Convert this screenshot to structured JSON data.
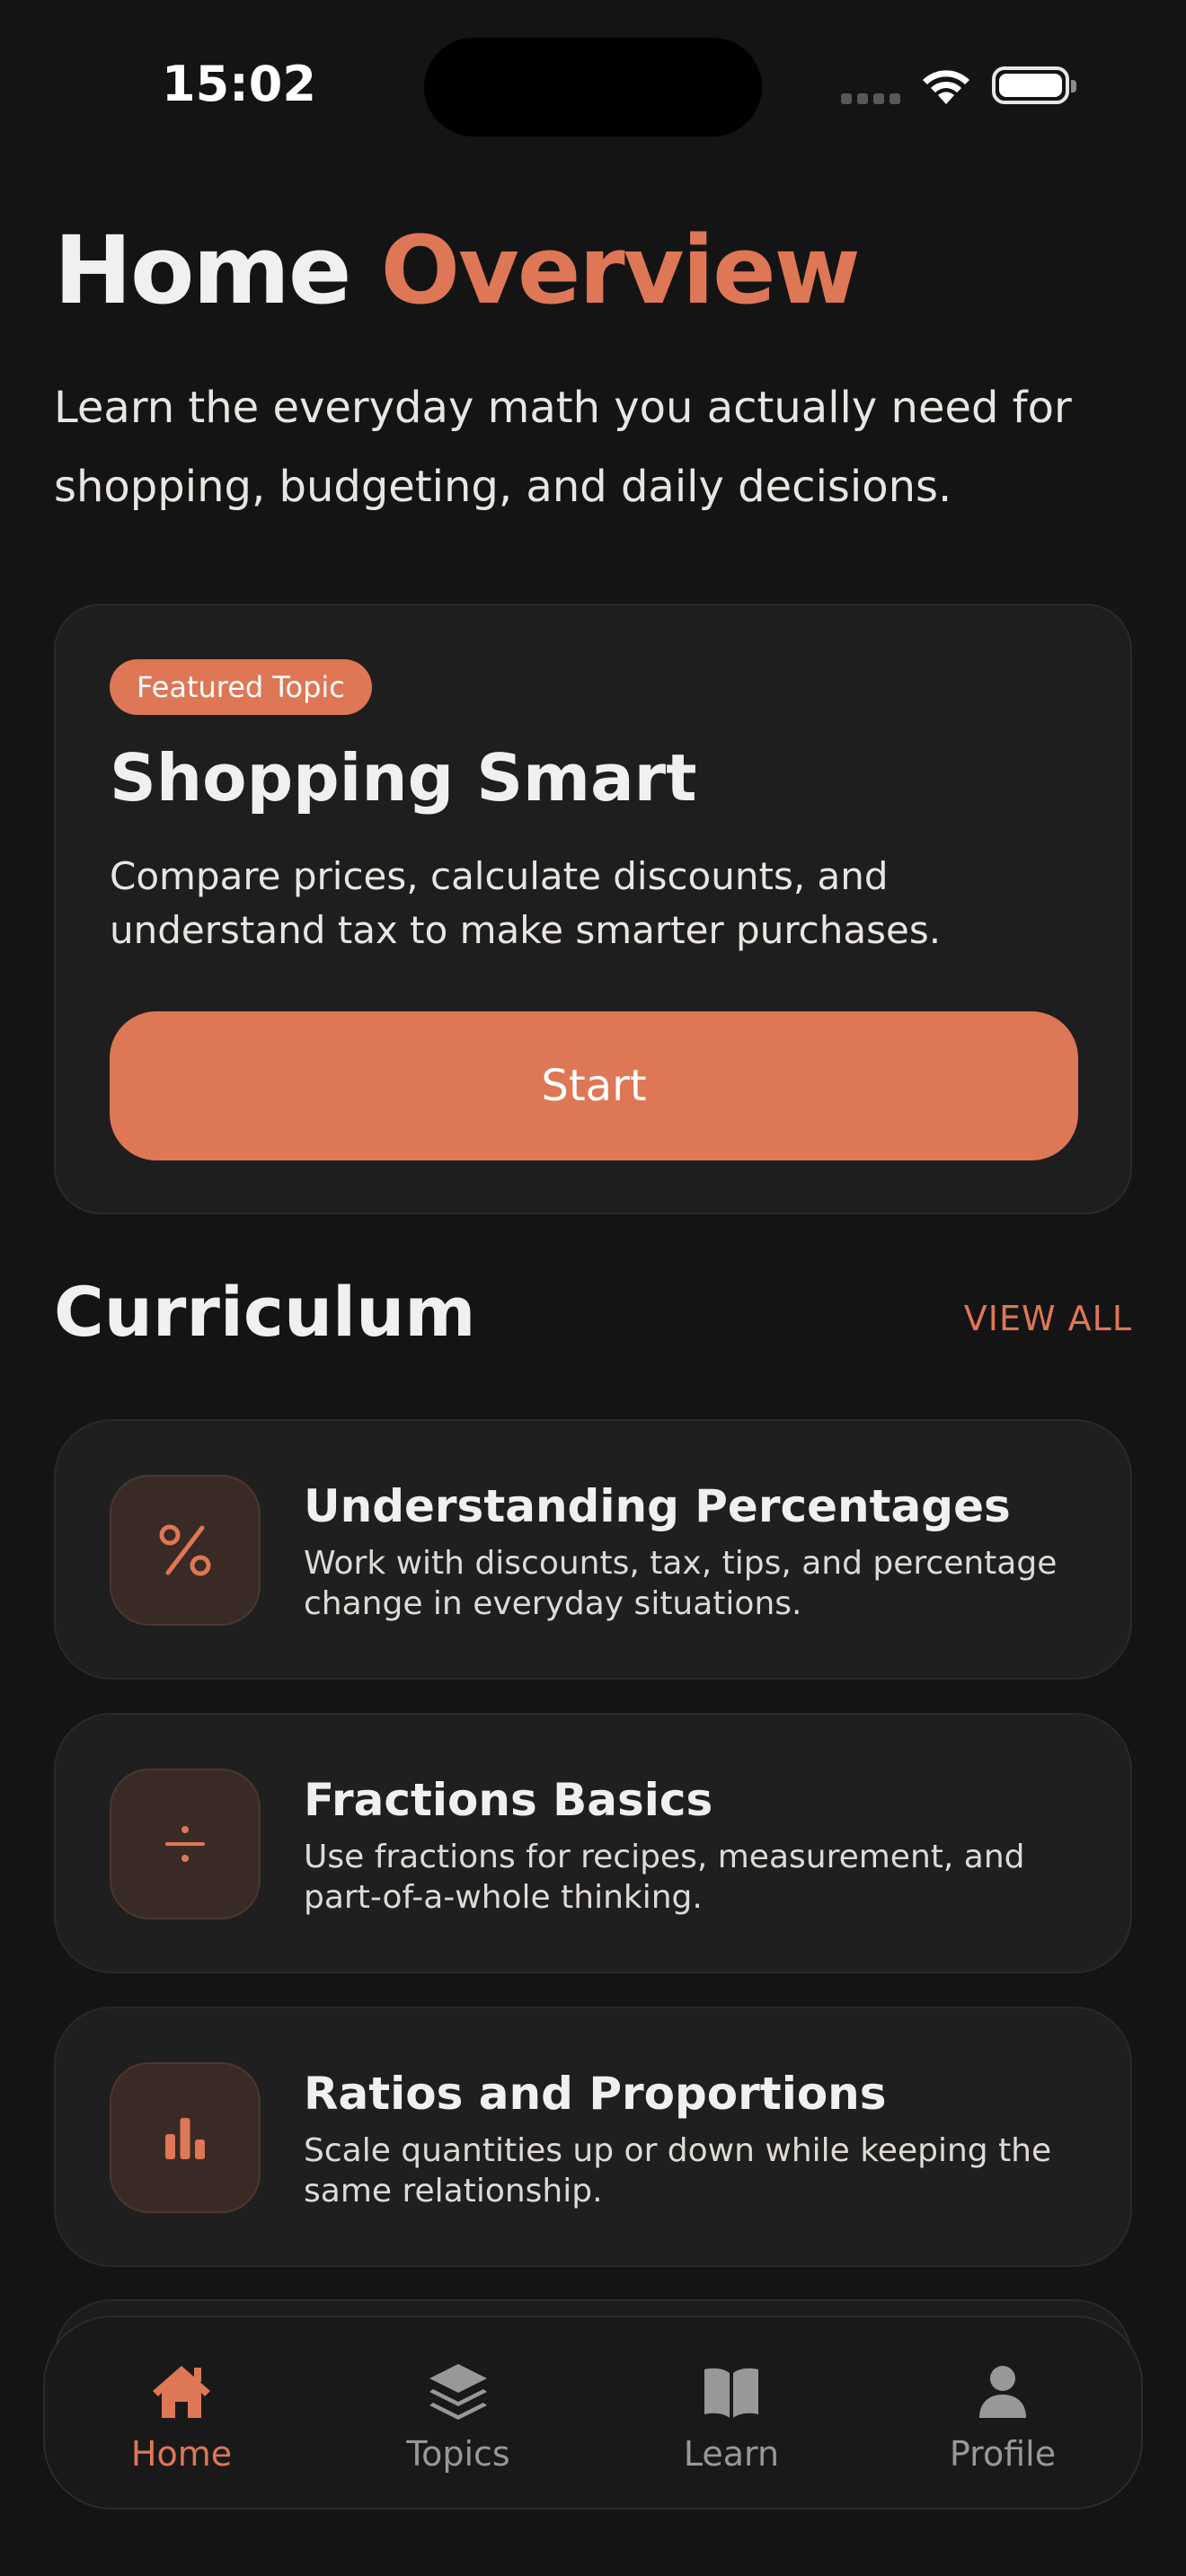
{
  "status_bar": {
    "time": "15:02"
  },
  "header": {
    "title_main": "Home",
    "title_accent": "Overview",
    "subtitle": "Learn the everyday math you actually need for shopping, budgeting, and daily decisions."
  },
  "featured": {
    "badge": "Featured Topic",
    "title": "Shopping Smart",
    "description": "Compare prices, calculate discounts, and understand tax to make smarter purchases.",
    "button_label": "Start"
  },
  "curriculum": {
    "title": "Curriculum",
    "view_all": "VIEW ALL",
    "topics": [
      {
        "title": "Understanding Percentages",
        "description": "Work with discounts, tax, tips, and percentage change in everyday situations.",
        "icon": "percent-icon"
      },
      {
        "title": "Fractions Basics",
        "description": "Use fractions for recipes, measurement, and part-of-a-whole thinking.",
        "icon": "divide-icon"
      },
      {
        "title": "Ratios and Proportions",
        "description": "Scale quantities up or down while keeping the same relationship.",
        "icon": "bar-chart-icon"
      }
    ]
  },
  "tab_bar": {
    "tabs": [
      {
        "label": "Home",
        "icon": "home-icon",
        "active": true
      },
      {
        "label": "Topics",
        "icon": "layers-icon",
        "active": false
      },
      {
        "label": "Learn",
        "icon": "book-icon",
        "active": false
      },
      {
        "label": "Profile",
        "icon": "person-icon",
        "active": false
      }
    ]
  },
  "colors": {
    "accent": "#de7756",
    "background": "#151414",
    "card": "#1f1e1e"
  }
}
